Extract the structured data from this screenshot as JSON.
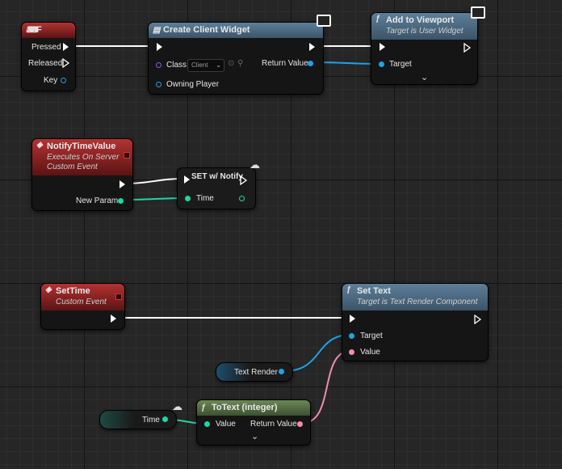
{
  "colors": {
    "exec": "#ffffff",
    "object": "#1da3e8",
    "int": "#1ed6a6",
    "text": "#f08cb4",
    "event_red": "#b43232",
    "function_blue": "#3b5468",
    "pure_green": "#6b8855"
  },
  "f_event": {
    "title": "F",
    "pins": {
      "pressed": "Pressed",
      "released": "Released",
      "key": "Key"
    }
  },
  "create_widget": {
    "title": "Create Client Widget",
    "class_label": "Class",
    "class_value": "Client",
    "owning_player": "Owning Player",
    "return_value": "Return Value"
  },
  "add_viewport": {
    "title": "Add to Viewport",
    "subtitle": "Target is User Widget",
    "target": "Target"
  },
  "notify_event": {
    "title": "NotifyTimeValue",
    "subtitle_1": "Executes On Server",
    "subtitle_2": "Custom Event",
    "new_param": "New Param"
  },
  "set_notify": {
    "title": "SET w/ Notify",
    "time": "Time"
  },
  "settime_event": {
    "title": "SetTime",
    "subtitle": "Custom Event"
  },
  "set_text": {
    "title": "Set Text",
    "subtitle": "Target is Text Render Component",
    "target": "Target",
    "value": "Value"
  },
  "text_render_var": {
    "label": "Text Render"
  },
  "time_var": {
    "label": "Time"
  },
  "to_text": {
    "title": "ToText (integer)",
    "value": "Value",
    "return_value": "Return Value"
  },
  "icons": [
    "keyboard-event-icon",
    "widget-icon",
    "function-icon",
    "event-icon",
    "network-icon",
    "monitor-icon",
    "expand-chevron-icon"
  ]
}
